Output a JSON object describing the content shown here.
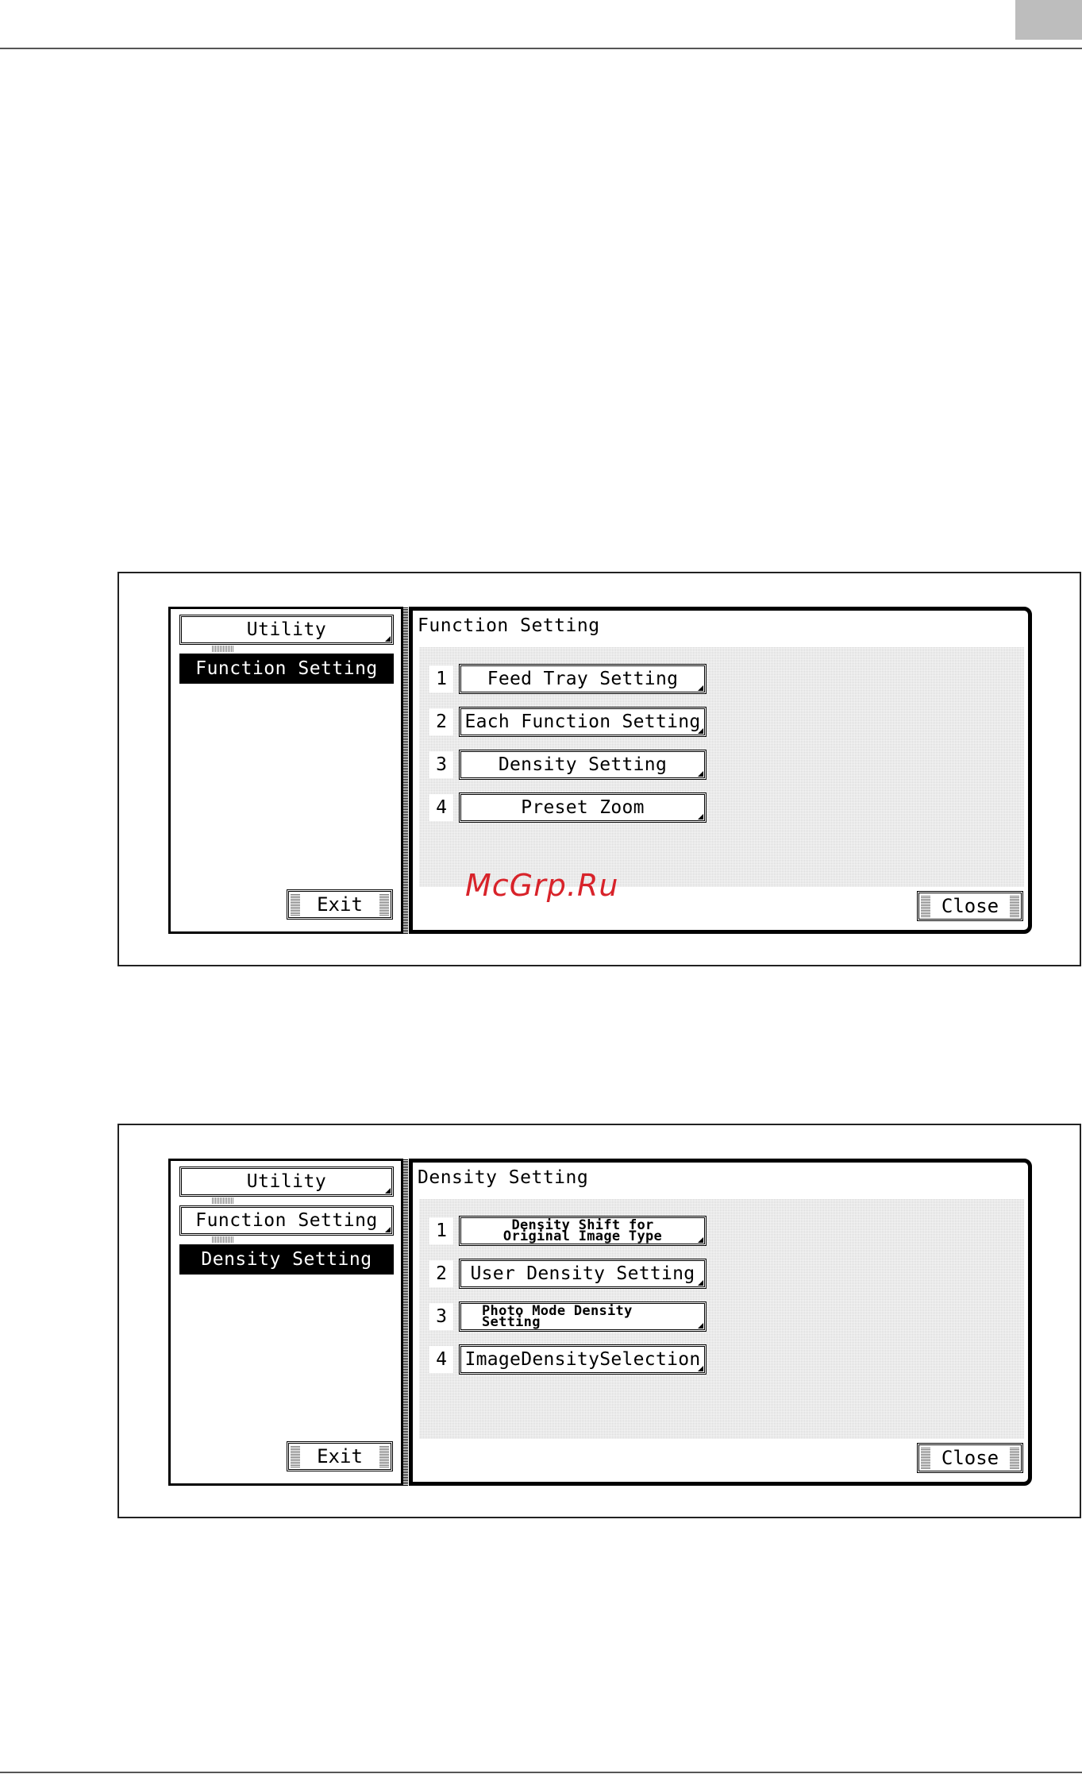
{
  "watermark": "McGrp.Ru",
  "screens": [
    {
      "breadcrumbs": [
        "Utility",
        "Function Setting"
      ],
      "exit_label": "Exit",
      "panel_title": "Function Setting",
      "options": [
        {
          "num": "1",
          "label": "Feed Tray Setting"
        },
        {
          "num": "2",
          "label": "Each Function Setting"
        },
        {
          "num": "3",
          "label": "Density Setting"
        },
        {
          "num": "4",
          "label": "Preset Zoom"
        }
      ],
      "close_label": "Close"
    },
    {
      "breadcrumbs": [
        "Utility",
        "Function Setting",
        "Density Setting"
      ],
      "exit_label": "Exit",
      "panel_title": "Density Setting",
      "options": [
        {
          "num": "1",
          "label_line1": "Density Shift for",
          "label_line2": "Original Image Type"
        },
        {
          "num": "2",
          "label": "User Density Setting"
        },
        {
          "num": "3",
          "label_line1": "Photo Mode Density",
          "label_line2": "Setting"
        },
        {
          "num": "4",
          "label": "ImageDensitySelection"
        }
      ],
      "close_label": "Close"
    }
  ]
}
